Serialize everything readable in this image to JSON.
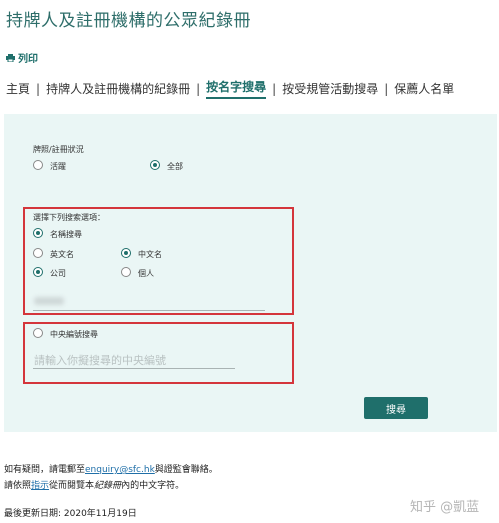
{
  "header": {
    "title": "持牌人及註冊機構的公眾紀錄冊",
    "print_label": "列印"
  },
  "nav": {
    "items": [
      "主頁",
      "持牌人及註冊機構的紀錄冊",
      "按名字搜尋",
      "按受規管活動搜尋",
      "保薦人名單"
    ],
    "active_index": 2
  },
  "form": {
    "status": {
      "label": "牌照/註冊狀況",
      "options": [
        {
          "label": "活躍",
          "checked": false
        },
        {
          "label": "全部",
          "checked": true
        }
      ]
    },
    "criteria_label": "選擇下列搜索選項：",
    "name_search": {
      "label": "名稱搜尋",
      "checked": true
    },
    "name_lang": [
      {
        "label": "英文名",
        "checked": false
      },
      {
        "label": "中文名",
        "checked": true
      }
    ],
    "entity_type": [
      {
        "label": "公司",
        "checked": true
      },
      {
        "label": "個人",
        "checked": false
      }
    ],
    "central_search": {
      "label": "中央編號搜尋",
      "checked": false,
      "placeholder": "請輸入你擬搜尋的中央編號"
    },
    "search_button": "搜尋"
  },
  "footer": {
    "contact_prefix": "如有疑問，請電郵至",
    "contact_email": "enquiry@sfc.hk",
    "contact_suffix": "與證監會聯絡。",
    "guide_prefix": "請依照",
    "guide_link": "指示",
    "guide_middle": "從而閱覽本",
    "guide_italic": "紀錄冊",
    "guide_suffix": "內的中文字符。",
    "last_updated": "最後更新日期: 2020年11月19日"
  },
  "watermark": "知乎 @凱蓝",
  "colors": {
    "accent": "#1f6f6b",
    "panel": "#eaf6f5",
    "highlight_box": "#d4353b"
  }
}
